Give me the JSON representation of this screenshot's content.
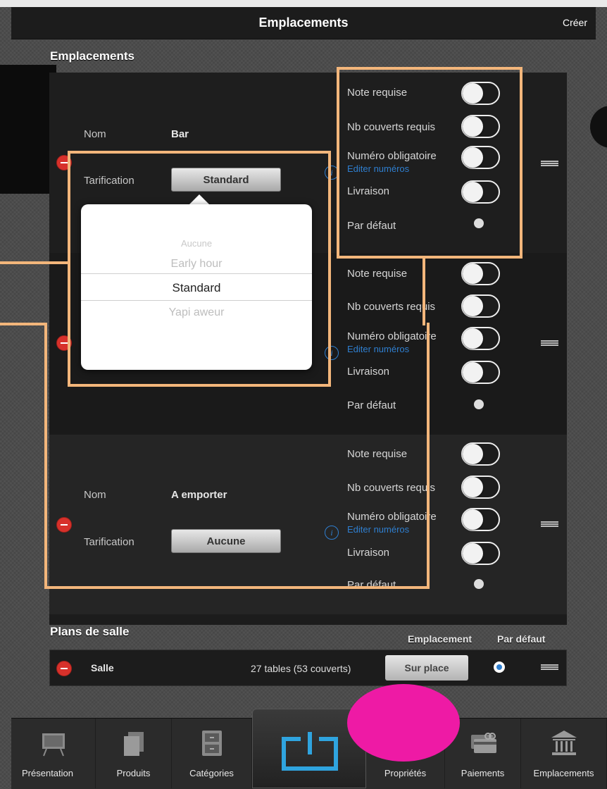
{
  "navbar": {
    "title": "Emplacements",
    "create_label": "Créer"
  },
  "locations_section": {
    "title": "Emplacements"
  },
  "labels": {
    "name": "Nom",
    "pricing": "Tarification",
    "note_required": "Note requise",
    "covers_required": "Nb couverts requis",
    "number_required": "Numéro obligatoire",
    "edit_numbers": "Editer numéros",
    "delivery": "Livraison",
    "default": "Par défaut"
  },
  "locations": [
    {
      "name": "Bar",
      "pricing": "Standard"
    },
    {
      "name": "",
      "pricing": ""
    },
    {
      "name": "A emporter",
      "pricing": "Aucune"
    }
  ],
  "picker": {
    "options": [
      "Aucune",
      "Early hour",
      "Standard",
      "Yapi aweur"
    ],
    "selected": "Standard"
  },
  "floor_plans": {
    "title": "Plans de salle",
    "col_location": "Emplacement",
    "col_default": "Par défaut",
    "rows": [
      {
        "name": "Salle",
        "tables": "27 tables (53 couverts)",
        "location": "Sur place"
      }
    ]
  },
  "tabs": [
    {
      "label": "Présentation",
      "icon": "presentation-board-icon"
    },
    {
      "label": "Produits",
      "icon": "documents-icon"
    },
    {
      "label": "Catégories",
      "icon": "cabinet-icon"
    },
    {
      "label": "",
      "icon": "power-icon"
    },
    {
      "label": "Propriétés",
      "icon": "properties-icon"
    },
    {
      "label": "Paiements",
      "icon": "payment-cards-icon"
    },
    {
      "label": "Emplacements",
      "icon": "building-icon"
    }
  ],
  "colors": {
    "accent_blue": "#2f7fd0",
    "delete_red": "#d7312b",
    "callout_orange": "#f3b67b",
    "highlight_pink": "#ee1aa5"
  }
}
